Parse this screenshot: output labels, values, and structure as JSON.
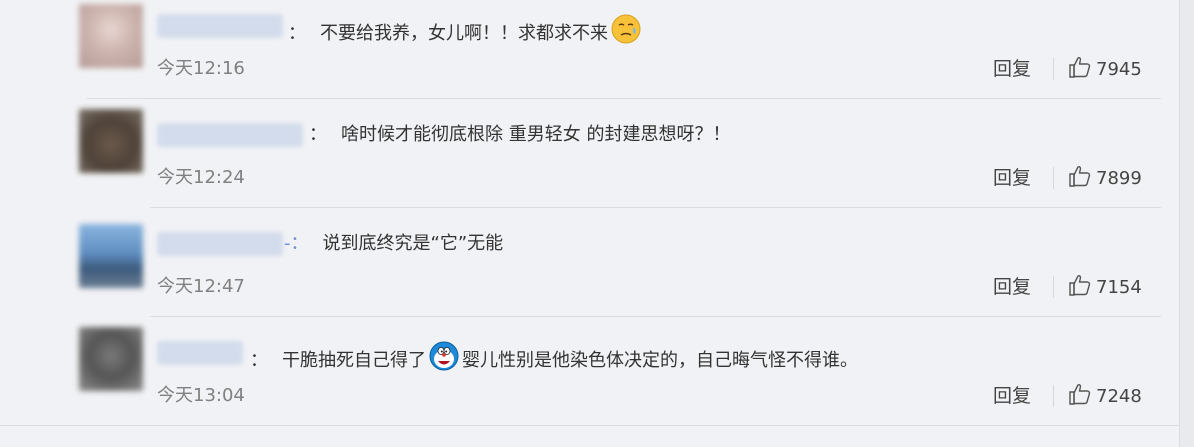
{
  "comments": [
    {
      "text_before": "不要给我养，女儿啊！！求都求不来",
      "emoji_before": "sweat-face",
      "text_after": "",
      "separator": "：",
      "time": "今天12:16",
      "reply_label": "回复",
      "likes": "7945"
    },
    {
      "text_before": "啥时候才能彻底根除 重男轻女 的封建思想呀？！",
      "emoji_before": "",
      "text_after": "",
      "separator": "：",
      "time": "今天12:24",
      "reply_label": "回复",
      "likes": "7899"
    },
    {
      "text_before": "说到底终究是“它”无能",
      "emoji_before": "",
      "text_after": "",
      "separator": "-：",
      "time": "今天12:47",
      "reply_label": "回复",
      "likes": "7154"
    },
    {
      "text_before": "干脆抽死自己得了",
      "emoji_before": "doraemon-sticker",
      "text_after": "婴儿性别是他染色体决定的，自己晦气怪不得谁。",
      "separator": "：",
      "time": "今天13:04",
      "reply_label": "回复",
      "likes": "7248"
    }
  ],
  "colors": {
    "background": "#f1f2f5",
    "text": "#333333",
    "time": "#808080",
    "divider": "#dcdde0"
  }
}
